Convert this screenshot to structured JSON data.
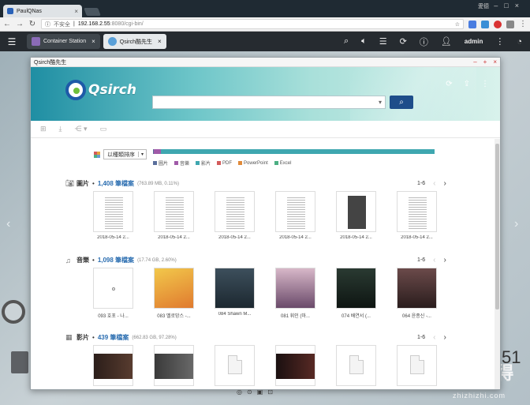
{
  "browser": {
    "tab_title": "PaulQNas",
    "window_user": "愛德",
    "security_label": "不安全",
    "url_host": "192.168.2.55",
    "url_rest": ":8080/cgi-bin/"
  },
  "qts": {
    "tabs": [
      {
        "label": "Container Station"
      },
      {
        "label": "Qsirch酷先生"
      }
    ],
    "user": "admin"
  },
  "app": {
    "window_title": "Qsirch酷先生",
    "logo_text": "Qsirch",
    "search_placeholder": "",
    "sort_label": "以種類排序",
    "type_legend": [
      {
        "label": "圖片",
        "color": "#5a6f9c",
        "fraction": 0.0011
      },
      {
        "label": "音樂",
        "color": "#a05aa8",
        "fraction": 0.026
      },
      {
        "label": "影片",
        "color": "#3fa7b0",
        "fraction": 0.9727
      },
      {
        "label": "PDF",
        "color": "#d35b5b",
        "fraction": 0
      },
      {
        "label": "PowerPoint",
        "color": "#e08a3a",
        "fraction": 0
      },
      {
        "label": "Excel",
        "color": "#4caf83",
        "fraction": 0
      }
    ],
    "sections": [
      {
        "icon": "📷",
        "name": "圖片",
        "count": "1,408 筆檔案",
        "size": "(763.89 MB, 0.11%)",
        "pager": "1-6",
        "items": [
          "2018-05-14 2...",
          "2018-05-14 2...",
          "2018-05-14 2...",
          "2018-05-14 2...",
          "2018-05-14 2...",
          "2018-05-14 2..."
        ]
      },
      {
        "icon": "♫",
        "name": "音樂",
        "count": "1,098 筆檔案",
        "size": "(17.74 GB, 2.60%)",
        "pager": "1-6",
        "items": [
          "093 호포 - 나...",
          "083 멜로망스 -...",
          "084 Shawn M...",
          "081 휘인 (마...",
          "074 배연서 (...",
          "064 윤종신 -..."
        ]
      },
      {
        "icon": "▦",
        "name": "影片",
        "count": "439 筆檔案",
        "size": "(662.83 GB, 97.28%)",
        "pager": "1-6",
        "items": [
          "",
          "",
          "",
          "",
          "",
          ""
        ]
      }
    ]
  },
  "desktop": {
    "clock": "51",
    "watermark": "值 值 得",
    "watermark_sub": "zhizhizhi.com"
  }
}
